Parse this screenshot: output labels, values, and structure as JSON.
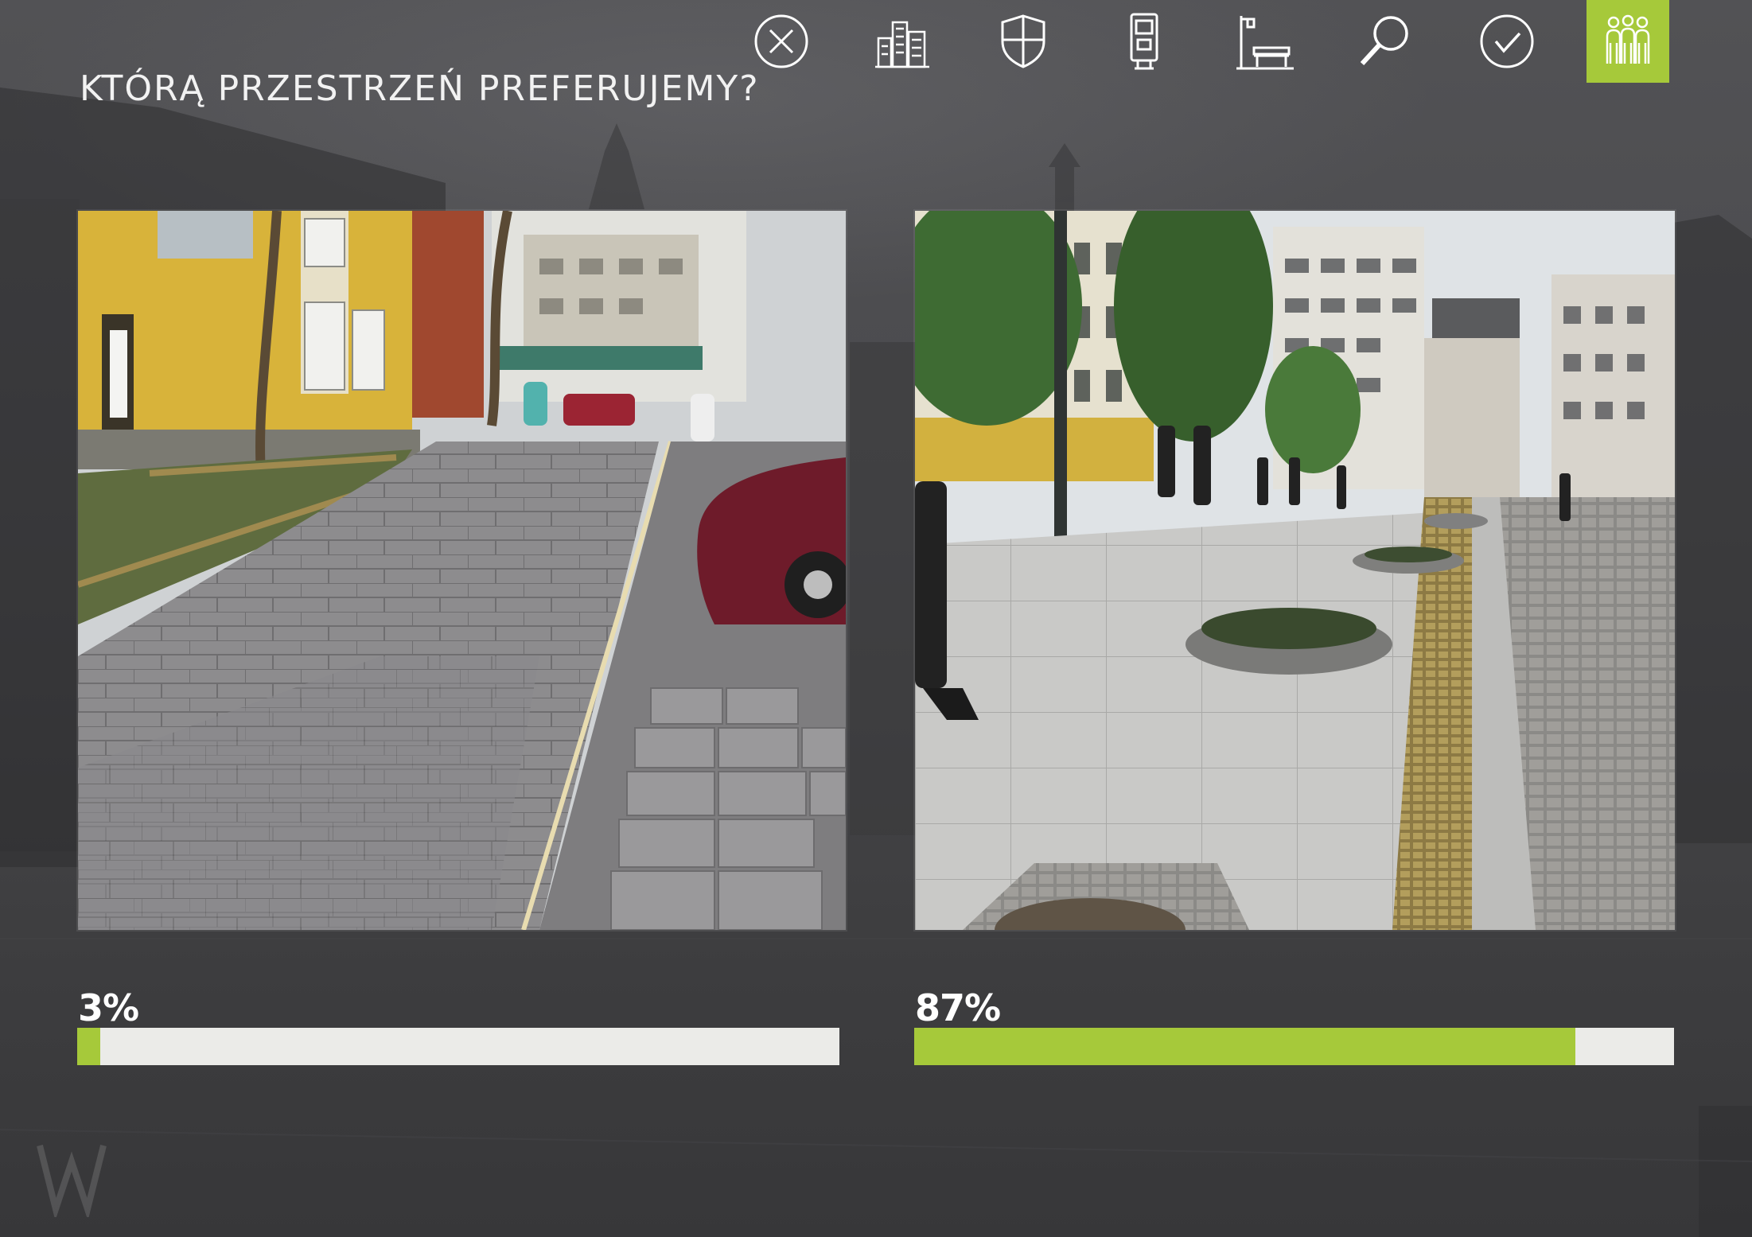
{
  "header": {
    "title": "KTÓRĄ PRZESTRZEŃ PREFERUJEMY?"
  },
  "toolbar": {
    "items": [
      {
        "icon": "close-circle-icon",
        "active": false
      },
      {
        "icon": "city-buildings-icon",
        "active": false
      },
      {
        "icon": "shield-icon",
        "active": false
      },
      {
        "icon": "ticket-machine-icon",
        "active": false
      },
      {
        "icon": "street-bench-icon",
        "active": false
      },
      {
        "icon": "search-icon",
        "active": false
      },
      {
        "icon": "check-circle-icon",
        "active": false
      },
      {
        "icon": "people-group-icon",
        "active": true
      }
    ],
    "active_color": "#a6c93a"
  },
  "options": [
    {
      "percent_label": "3%",
      "fraction": 0.03
    },
    {
      "percent_label": "87%",
      "fraction": 0.87
    }
  ],
  "colors": {
    "accent": "#a6c93a",
    "bar_track": "#ebebe8",
    "background": "#4d4d4f"
  }
}
